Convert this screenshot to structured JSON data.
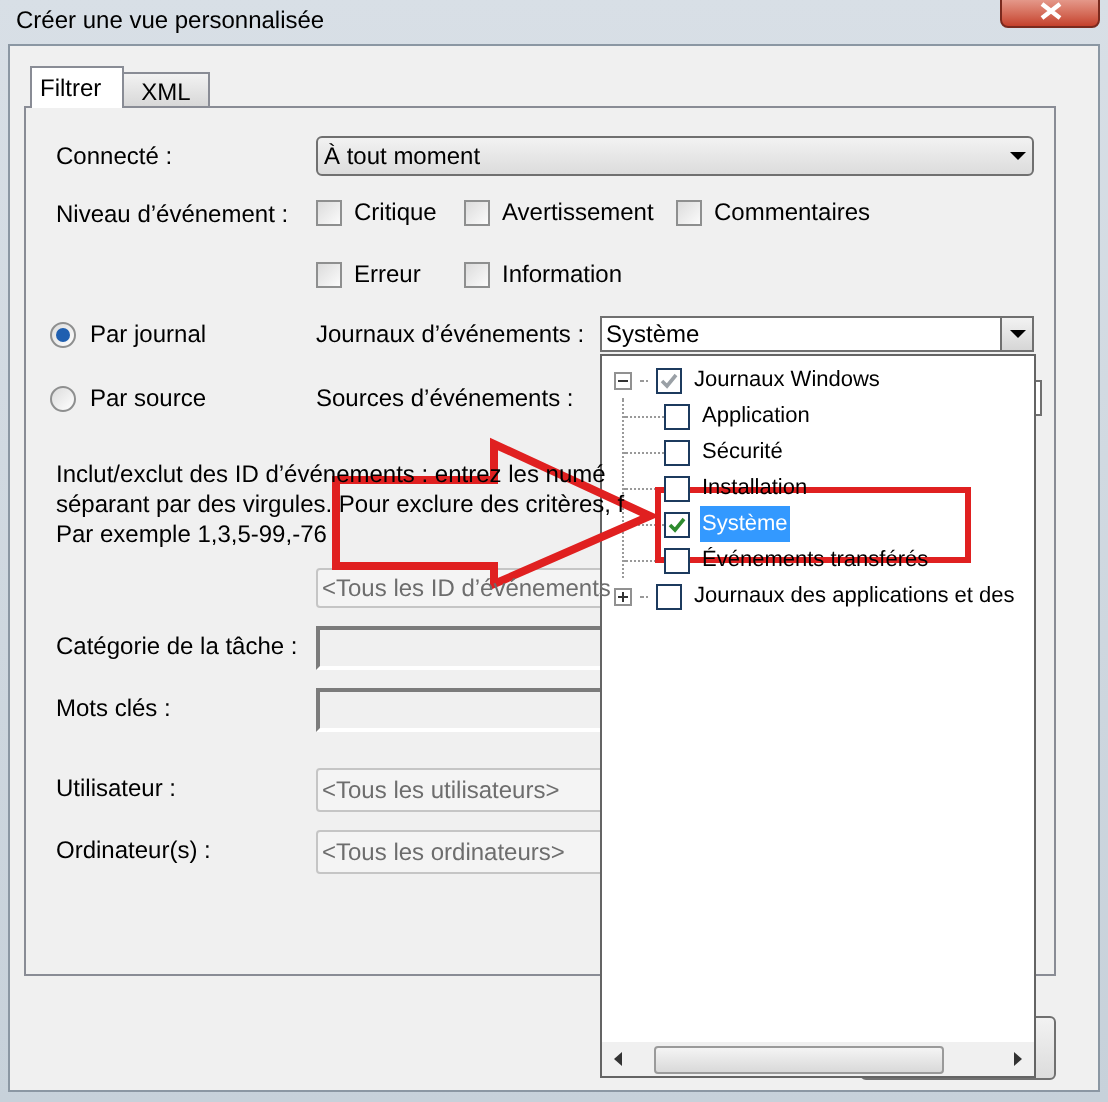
{
  "window": {
    "title": "Créer une vue personnalisée"
  },
  "tabs": [
    {
      "label": "Filtrer",
      "selected": true
    },
    {
      "label": "XML",
      "selected": false
    }
  ],
  "logged": {
    "label": "Connecté :",
    "value": "À tout moment"
  },
  "event_level": {
    "label": "Niveau d’événement :",
    "options": [
      {
        "label": "Critique",
        "checked": false
      },
      {
        "label": "Avertissement",
        "checked": false
      },
      {
        "label": "Commentaires",
        "checked": false
      },
      {
        "label": "Erreur",
        "checked": false
      },
      {
        "label": "Information",
        "checked": false
      }
    ]
  },
  "scope": [
    {
      "label": "Par journal",
      "selected": true,
      "field_label": "Journaux d’événements :",
      "value": "Système"
    },
    {
      "label": "Par source",
      "selected": false,
      "field_label": "Sources d’événements :"
    }
  ],
  "event_ids": {
    "description": [
      "Inclut/exclut des ID d’événements : entrez les numé",
      "séparant par des virgules. Pour exclure des critères, f",
      "Par exemple 1,3,5-99,-76"
    ],
    "placeholder": "<Tous les ID d’événements"
  },
  "fields": [
    {
      "label": "Catégorie de la tâche :",
      "kind": "combo"
    },
    {
      "label": "Mots clés :",
      "kind": "combo"
    },
    {
      "label": "Utilisateur :",
      "kind": "text",
      "placeholder": "<Tous les utilisateurs>"
    },
    {
      "label": "Ordinateur(s) :",
      "kind": "text",
      "placeholder": "<Tous les ordinateurs>"
    }
  ],
  "log_tree": [
    {
      "label": "Journaux Windows",
      "expanded": true,
      "checked": true,
      "partial": true,
      "children": [
        {
          "label": "Application",
          "checked": false,
          "selected": false
        },
        {
          "label": "Sécurité",
          "checked": false,
          "selected": false
        },
        {
          "label": "Installation",
          "checked": false,
          "selected": false
        },
        {
          "label": "Système",
          "checked": true,
          "selected": true
        },
        {
          "label": "Événements transférés",
          "checked": false,
          "selected": false
        }
      ]
    },
    {
      "label": "Journaux des applications et des",
      "expanded": false,
      "checked": false
    }
  ]
}
